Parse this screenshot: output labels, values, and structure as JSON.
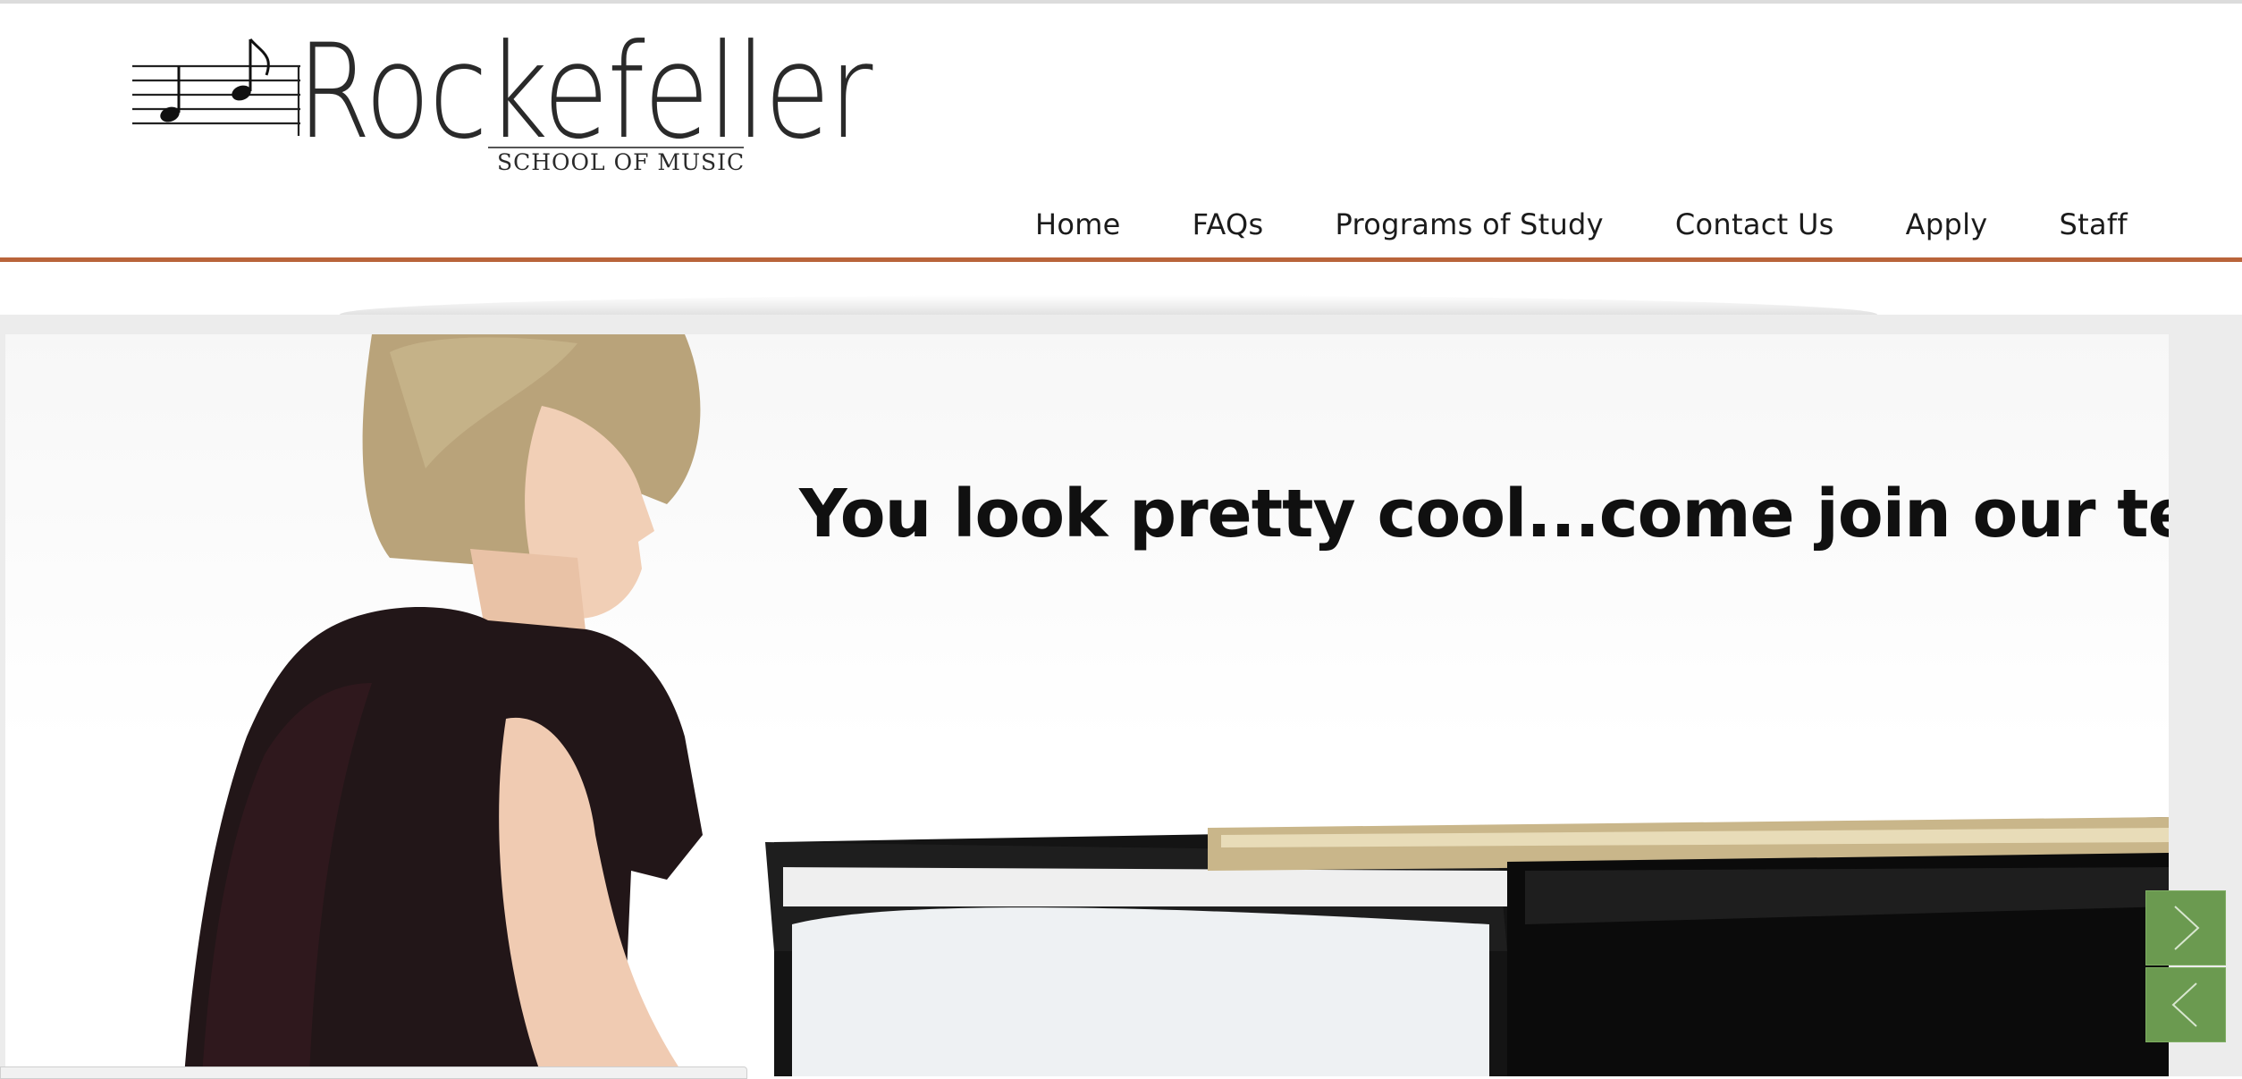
{
  "logo": {
    "wordmark": "Rockefeller",
    "tagline": "SCHOOL OF MUSIC"
  },
  "nav": {
    "items": [
      {
        "label": "Home"
      },
      {
        "label": "FAQs"
      },
      {
        "label": "Programs of Study"
      },
      {
        "label": "Contact Us"
      },
      {
        "label": "Apply"
      },
      {
        "label": "Staff"
      }
    ]
  },
  "slider": {
    "caption": "You look pretty cool...come join our team",
    "next_icon": "chevron-right-icon",
    "prev_icon": "chevron-left-icon"
  },
  "colors": {
    "accent": "#b9643a",
    "slider_button": "#6b9a50"
  }
}
